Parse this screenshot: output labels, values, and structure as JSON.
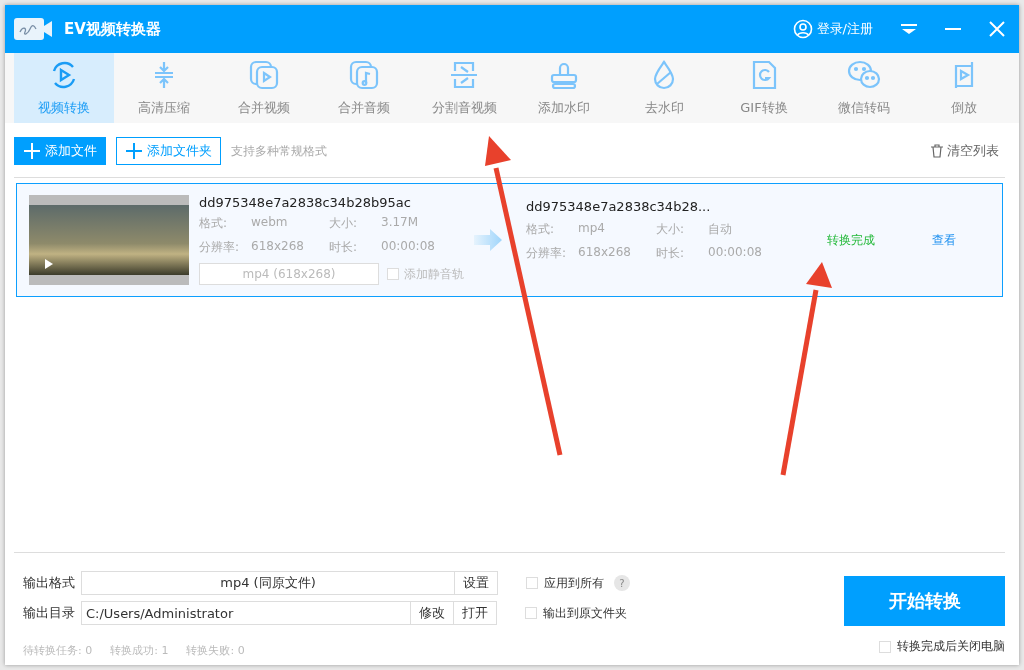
{
  "window": {
    "title": "EV视频转换器",
    "login": "登录/注册"
  },
  "tabs": [
    {
      "label": "视频转换",
      "selected": true
    },
    {
      "label": "高清压缩",
      "selected": false
    },
    {
      "label": "合并视频",
      "selected": false
    },
    {
      "label": "合并音频",
      "selected": false
    },
    {
      "label": "分割音视频",
      "selected": false
    },
    {
      "label": "添加水印",
      "selected": false
    },
    {
      "label": "去水印",
      "selected": false
    },
    {
      "label": "GIF转换",
      "selected": false
    },
    {
      "label": "微信转码",
      "selected": false
    },
    {
      "label": "倒放",
      "selected": false
    }
  ],
  "actions": {
    "add_file": "添加文件",
    "add_folder": "添加文件夹",
    "hint": "支持多种常规格式",
    "clear": "清空列表"
  },
  "files": [
    {
      "selected": true,
      "source": {
        "name": "dd975348e7a2838c34b28b95ac",
        "fields": [
          {
            "label": "格式:",
            "value": "webm"
          },
          {
            "label": "大小:",
            "value": "3.17M"
          },
          {
            "label": "分辨率:",
            "value": "618x268"
          },
          {
            "label": "时长:",
            "value": "00:00:08"
          }
        ]
      },
      "target_format": "mp4 (618x268)",
      "mute_track": {
        "label": "添加静音轨",
        "checked": false
      },
      "output": {
        "name": "dd975348e7a2838c34b28...",
        "fields": [
          {
            "label": "格式:",
            "value": "mp4"
          },
          {
            "label": "大小:",
            "value": "自动"
          },
          {
            "label": "分辨率:",
            "value": "618x268"
          },
          {
            "label": "时长:",
            "value": "00:00:08"
          }
        ]
      },
      "status": "转换完成",
      "view": "查看"
    }
  ],
  "output": {
    "format_label": "输出格式",
    "format": "mp4 (同原文件)",
    "settings": "设置",
    "dir_label": "输出目录",
    "dir": "C:/Users/Administrator",
    "change": "修改",
    "open": "打开",
    "options": [
      {
        "label": "应用到所有",
        "checked": false,
        "help": "?"
      },
      {
        "label": "输出到原文件夹",
        "checked": false
      }
    ],
    "start": "开始转换",
    "shutdown": {
      "label": "转换完成后关闭电脑",
      "checked": false
    }
  },
  "status_bar": [
    {
      "label": "待转换任务:",
      "value": "0"
    },
    {
      "label": "转换成功:",
      "value": "1"
    },
    {
      "label": "转换失败:",
      "value": "0"
    }
  ]
}
